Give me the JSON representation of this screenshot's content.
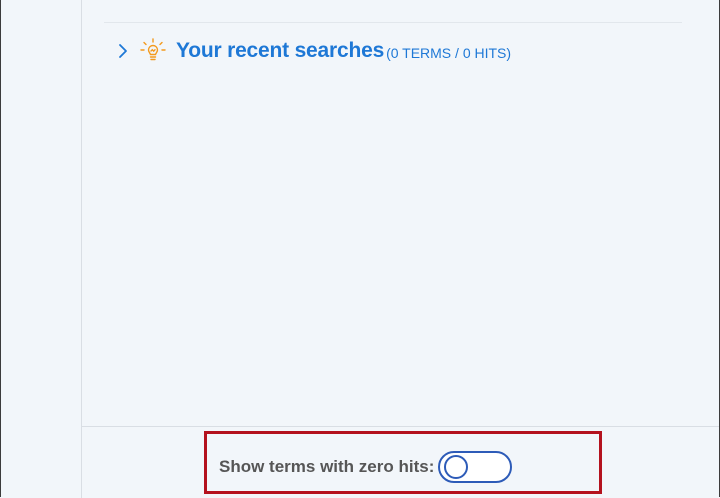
{
  "recent_searches": {
    "title": "Your recent searches",
    "counts": "(0 TERMS / 0 HITS)",
    "expand_icon": "chevron-right-icon",
    "icon": "lightbulb-icon"
  },
  "footer": {
    "toggle_label": "Show terms with zero hits:",
    "toggle_on": false
  },
  "colors": {
    "accent": "#1e78d6",
    "highlight": "#b4121e",
    "icon_orange": "#f39a1e",
    "toggle_border": "#2d5bb8"
  }
}
